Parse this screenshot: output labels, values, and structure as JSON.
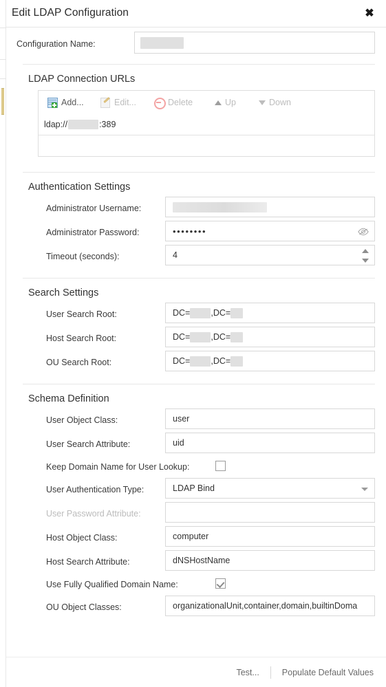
{
  "window": {
    "title": "Edit LDAP Configuration",
    "close_icon": "close-icon",
    "close_glyph": "✖"
  },
  "config_name": {
    "label": "Configuration Name:",
    "value": "",
    "redacted": true
  },
  "sections": {
    "urls": {
      "title": "LDAP Connection URLs",
      "toolbar": [
        {
          "label": "Add...",
          "icon": "add-document-icon",
          "enabled": true
        },
        {
          "label": "Edit...",
          "icon": "edit-pencil-icon",
          "enabled": false
        },
        {
          "label": "Delete",
          "icon": "delete-circle-icon",
          "enabled": false
        },
        {
          "label": "Up",
          "icon": "arrow-up-icon",
          "enabled": false
        },
        {
          "label": "Down",
          "icon": "arrow-down-icon",
          "enabled": false
        }
      ],
      "rows": [
        {
          "prefix": "ldap://",
          "host_redacted": true,
          "suffix": ":389"
        }
      ]
    },
    "auth": {
      "title": "Authentication Settings",
      "fields": [
        {
          "label": "Administrator Username:",
          "value": "",
          "redacted": true,
          "type": "text"
        },
        {
          "label": "Administrator Password:",
          "value": "••••••••",
          "type": "password",
          "reveal_icon": "eye-slash-icon"
        },
        {
          "label": "Timeout (seconds):",
          "value": "4",
          "type": "spinner",
          "spinner_icon": "spinner-arrows-icon"
        }
      ]
    },
    "search": {
      "title": "Search Settings",
      "fields": [
        {
          "label": "User Search Root:",
          "prefix": "DC=",
          "mid": ",DC=",
          "redacted": true,
          "type": "dn"
        },
        {
          "label": "Host Search Root:",
          "prefix": "DC=",
          "mid": ",DC=",
          "redacted": true,
          "type": "dn"
        },
        {
          "label": "OU Search Root:",
          "prefix": "DC=",
          "mid": ",DC=",
          "redacted": true,
          "type": "dn"
        }
      ]
    },
    "schema": {
      "title": "Schema Definition",
      "fields": [
        {
          "label": "User Object Class:",
          "value": "user",
          "type": "text"
        },
        {
          "label": "User Search Attribute:",
          "value": "uid",
          "type": "text"
        },
        {
          "label": "Keep Domain Name for User Lookup:",
          "type": "checkbox",
          "checked": false
        },
        {
          "label": "User Authentication Type:",
          "value": "LDAP Bind",
          "type": "select",
          "caret_icon": "chevron-down-icon"
        },
        {
          "label": "User Password Attribute:",
          "value": "",
          "type": "text",
          "disabled": true
        },
        {
          "label": "Host Object Class:",
          "value": "computer",
          "type": "text"
        },
        {
          "label": "Host Search Attribute:",
          "value": "dNSHostName",
          "type": "text"
        },
        {
          "label": "Use Fully Qualified Domain Name:",
          "type": "checkbox",
          "checked": true
        },
        {
          "label": "OU Object Classes:",
          "value": "organizationalUnit,container,domain,builtinDoma",
          "type": "text"
        }
      ]
    }
  },
  "footer": {
    "test_label": "Test...",
    "populate_label": "Populate Default Values"
  },
  "colors": {
    "accent_bar": "#ddc98a",
    "add_icon_green": "#3fa93f",
    "delete_icon_red": "#f3a3a3",
    "border": "#d8d8d8",
    "text": "#333333",
    "disabled_text": "#bcbcbc",
    "redaction": "#e0e0e0"
  }
}
